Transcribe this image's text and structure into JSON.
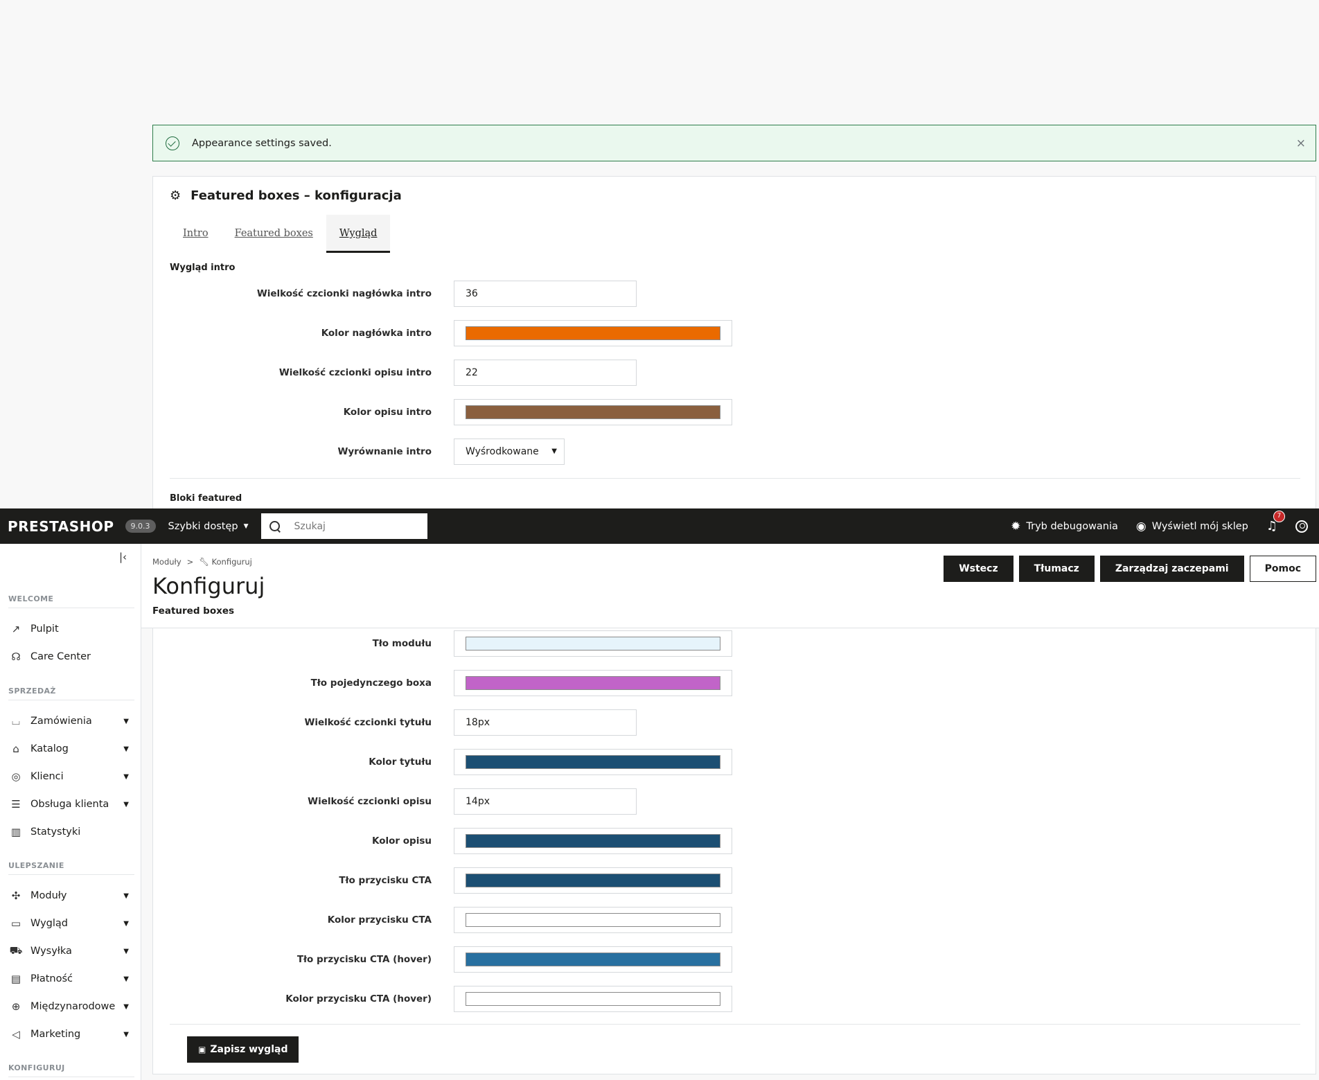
{
  "alert": {
    "message": "Appearance settings saved.",
    "close": "×"
  },
  "card": {
    "title": "Featured boxes – konfiguracja",
    "tabs": [
      {
        "label": "Intro",
        "active": false
      },
      {
        "label": "Featured boxes",
        "active": false
      },
      {
        "label": "Wygląd",
        "active": true
      }
    ],
    "intro_section": {
      "title": "Wygląd intro",
      "fields": [
        {
          "label": "Wielkość czcionki nagłówka intro",
          "type": "text",
          "value": "36"
        },
        {
          "label": "Kolor nagłówka intro",
          "type": "color",
          "value": "#ea6a00"
        },
        {
          "label": "Wielkość czcionki opisu intro",
          "type": "text",
          "value": "22"
        },
        {
          "label": "Kolor opisu intro",
          "type": "color",
          "value": "#8a5f3e"
        },
        {
          "label": "Wyrównanie intro",
          "type": "select",
          "value": "Wyśrodkowane"
        }
      ]
    },
    "featured_section": {
      "title": "Bloki featured",
      "fields": [
        {
          "label": "Tło modułu",
          "type": "color",
          "value": "#e6f4fb"
        },
        {
          "label": "Tło pojedynczego boxa",
          "type": "color",
          "value": "#c164c8"
        },
        {
          "label": "Wielkość czcionki tytułu",
          "type": "text",
          "value": "18px"
        },
        {
          "label": "Kolor tytułu",
          "type": "color",
          "value": "#1c4f73"
        },
        {
          "label": "Wielkość czcionki opisu",
          "type": "text",
          "value": "14px"
        },
        {
          "label": "Kolor opisu",
          "type": "color",
          "value": "#1c4f73"
        },
        {
          "label": "Tło przycisku CTA",
          "type": "color",
          "value": "#1c4f73"
        },
        {
          "label": "Kolor przycisku CTA",
          "type": "color",
          "value": "#ffffff"
        },
        {
          "label": "Tło przycisku CTA (hover)",
          "type": "color",
          "value": "#2870a0"
        },
        {
          "label": "Kolor przycisku CTA (hover)",
          "type": "color",
          "value": "#ffffff"
        }
      ]
    },
    "save_label": "Zapisz wygląd"
  },
  "topbar": {
    "logo": "PRESTASHOP",
    "version": "9.0.3",
    "quick_access": "Szybki dostęp",
    "search_placeholder": "Szukaj",
    "debug": "Tryb debugowania",
    "view_shop": "Wyświetl mój sklep",
    "notifications_count": "7"
  },
  "sidebar": {
    "groups": [
      {
        "label": "WELCOME",
        "items": [
          {
            "label": "Pulpit",
            "icon": "trending-up-icon",
            "chevron": false
          },
          {
            "label": "Care Center",
            "icon": "headset-icon",
            "chevron": false
          }
        ]
      },
      {
        "label": "SPRZEDAŻ",
        "items": [
          {
            "label": "Zamówienia",
            "icon": "basket-icon",
            "chevron": true
          },
          {
            "label": "Katalog",
            "icon": "store-icon",
            "chevron": true
          },
          {
            "label": "Klienci",
            "icon": "account-circle-icon",
            "chevron": true
          },
          {
            "label": "Obsługa klienta",
            "icon": "chat-icon",
            "chevron": true
          },
          {
            "label": "Statystyki",
            "icon": "bar-chart-icon",
            "chevron": false
          }
        ]
      },
      {
        "label": "ULEPSZANIE",
        "items": [
          {
            "label": "Moduły",
            "icon": "puzzle-icon",
            "chevron": true
          },
          {
            "label": "Wygląd",
            "icon": "desktop-icon",
            "chevron": true
          },
          {
            "label": "Wysyłka",
            "icon": "truck-icon",
            "chevron": true
          },
          {
            "label": "Płatność",
            "icon": "credit-card-icon",
            "chevron": true
          },
          {
            "label": "Międzynarodowe",
            "icon": "globe-icon",
            "chevron": true
          },
          {
            "label": "Marketing",
            "icon": "megaphone-icon",
            "chevron": true
          }
        ]
      },
      {
        "label": "KONFIGURUJ",
        "items": []
      }
    ]
  },
  "page": {
    "breadcrumb": [
      "Moduły",
      ">",
      "Konfiguruj"
    ],
    "title": "Konfiguruj",
    "subtitle": "Featured boxes",
    "actions": [
      {
        "label": "Wstecz",
        "style": "dark"
      },
      {
        "label": "Tłumacz",
        "style": "dark"
      },
      {
        "label": "Zarządzaj zaczepami",
        "style": "dark"
      },
      {
        "label": "Pomoc",
        "style": "outline"
      }
    ]
  }
}
